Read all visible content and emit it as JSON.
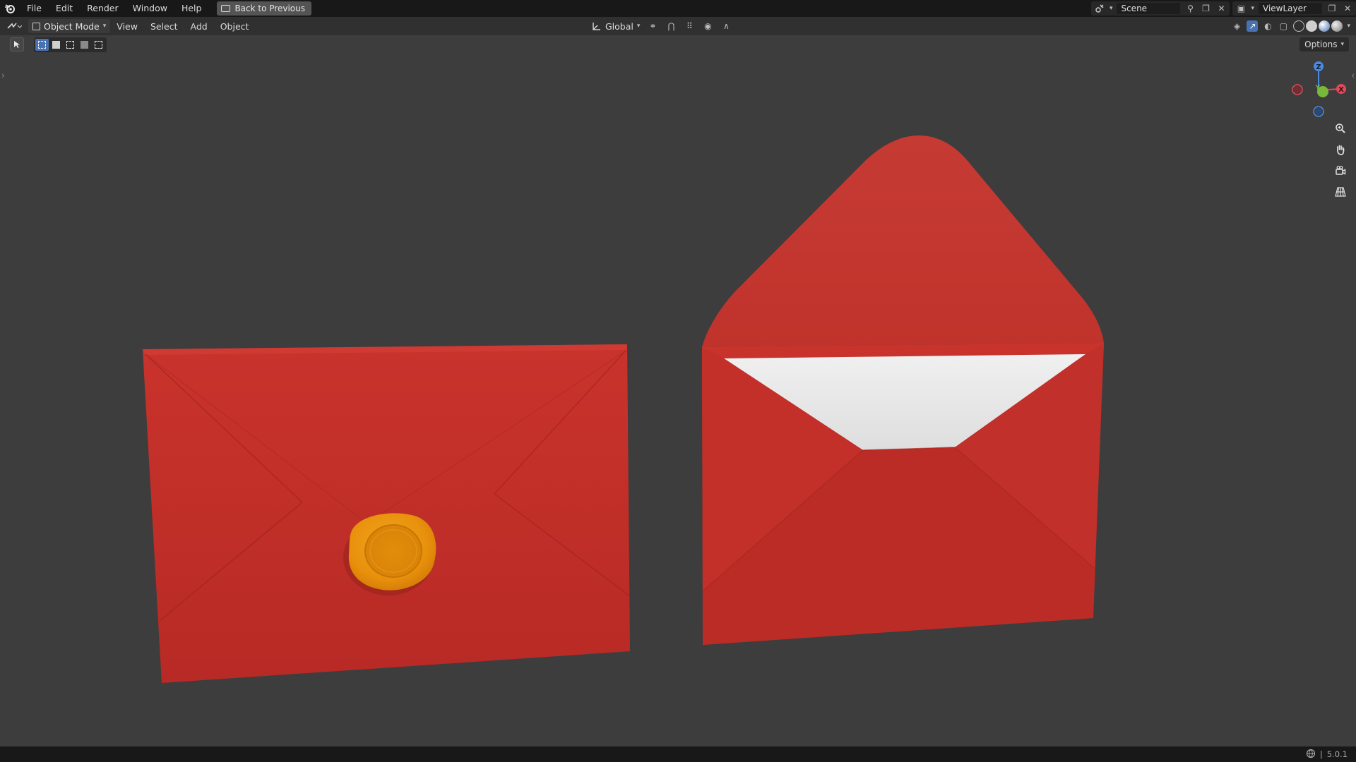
{
  "menubar": {
    "items": [
      "File",
      "Edit",
      "Render",
      "Window",
      "Help"
    ],
    "back_button": "Back to Previous",
    "scene_name": "Scene",
    "view_layer": "ViewLayer"
  },
  "header": {
    "mode": "Object Mode",
    "menus": [
      "View",
      "Select",
      "Add",
      "Object"
    ],
    "orientation": "Global"
  },
  "toolbar": {
    "options_label": "Options"
  },
  "gizmo": {
    "z": "Z",
    "y": "Y",
    "x": "X"
  },
  "status": {
    "version": "5.0.1"
  },
  "colors": {
    "viewport_bg": "#3d3d3d",
    "envelope_red": "#c1302a",
    "letter_white": "#e8e8e8",
    "wax_seal": "#e8900c",
    "accent_blue": "#4772b3"
  }
}
